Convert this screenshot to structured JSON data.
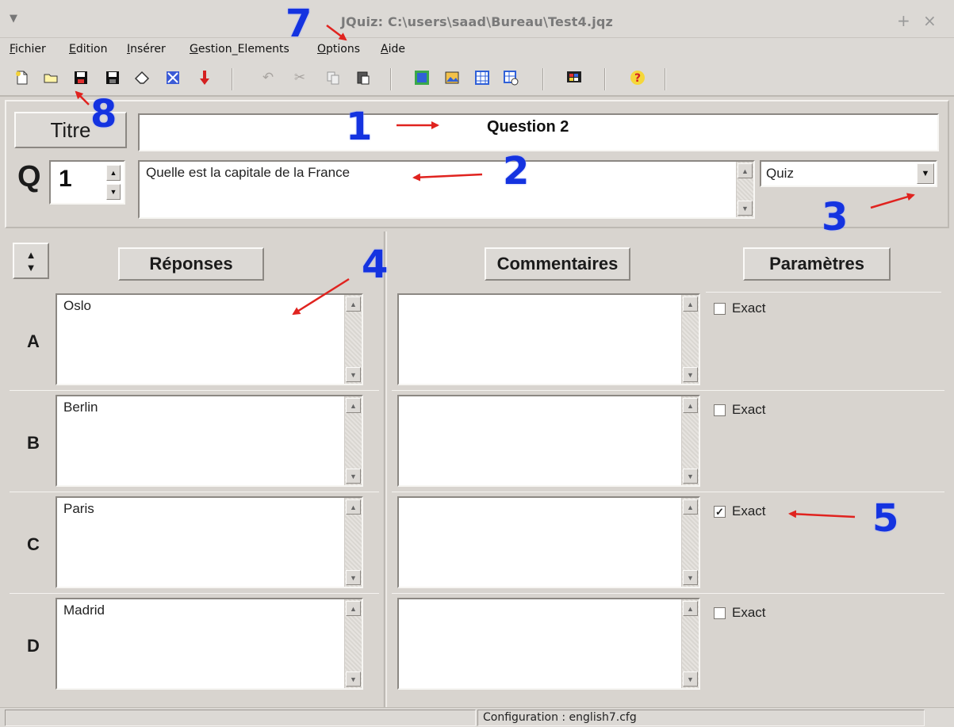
{
  "window": {
    "title": "JQuiz: C:\\users\\saad\\Bureau\\Test4.jqz",
    "menu_icon": "chevron-down-icon",
    "maximize_label": "+",
    "close_label": "×"
  },
  "menubar": {
    "items": [
      "Fichier",
      "Edition",
      "Insérer",
      "Gestion_Elements",
      "Options",
      "Aide"
    ]
  },
  "toolbar": {
    "groups": [
      [
        "new-file-icon",
        "open-folder-icon",
        "save-icon",
        "save-as-icon",
        "eraser-icon",
        "web-export-icon",
        "download-arrow-icon"
      ],
      [
        "undo-icon",
        "cut-icon",
        "copy-icon",
        "paste-icon"
      ],
      [
        "web-page-icon",
        "image-icon",
        "settings-grid-icon",
        "hand-pointer-icon"
      ],
      [
        "palette-icon"
      ],
      [
        "help-icon"
      ]
    ]
  },
  "header": {
    "title_button": "Titre",
    "title_value": "Question 2",
    "q_label": "Q",
    "q_number": "1",
    "question_text": "Quelle est la capitale de la France",
    "question_type": "Quiz"
  },
  "columns": {
    "reponses": "Réponses",
    "commentaires": "Commentaires",
    "parametres": "Paramètres"
  },
  "answers": [
    {
      "letter": "A",
      "text": "Oslo",
      "comment": "",
      "exact_label": "Exact",
      "exact": false
    },
    {
      "letter": "B",
      "text": "Berlin",
      "comment": "",
      "exact_label": "Exact",
      "exact": false
    },
    {
      "letter": "C",
      "text": "Paris",
      "comment": "",
      "exact_label": "Exact",
      "exact": true
    },
    {
      "letter": "D",
      "text": "Madrid",
      "comment": "",
      "exact_label": "Exact",
      "exact": false
    }
  ],
  "status": {
    "config": "Configuration : english7.cfg"
  },
  "annotations": {
    "n1": "1",
    "n2": "2",
    "n3": "3",
    "n4": "4",
    "n5": "5",
    "n7": "7",
    "n8": "8",
    "number_color": "#1433e0",
    "arrow_color": "#e0231f"
  }
}
